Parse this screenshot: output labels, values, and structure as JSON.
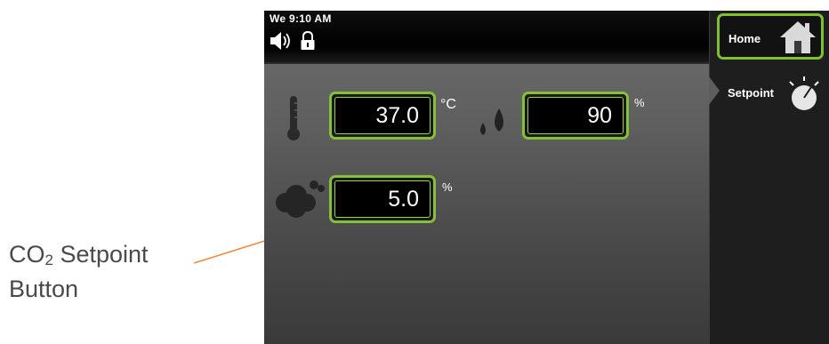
{
  "status_bar": {
    "datetime": "We 9:10 AM",
    "icons": [
      "speaker-icon",
      "lock-icon"
    ]
  },
  "nav": {
    "home_label": "Home",
    "setpoint_label": "Setpoint"
  },
  "readings": {
    "temperature": {
      "value": "37.0",
      "unit": "°C"
    },
    "humidity": {
      "value": "90",
      "unit": "%"
    },
    "co2": {
      "value": "5.0",
      "unit": "%"
    }
  },
  "annotation": {
    "line1_main": "CO",
    "line1_sub": "2",
    "line1_rest": " Setpoint",
    "line2": "Button"
  },
  "colors": {
    "accent_green": "#86c03a",
    "arrow_orange": "#f08a3c"
  }
}
